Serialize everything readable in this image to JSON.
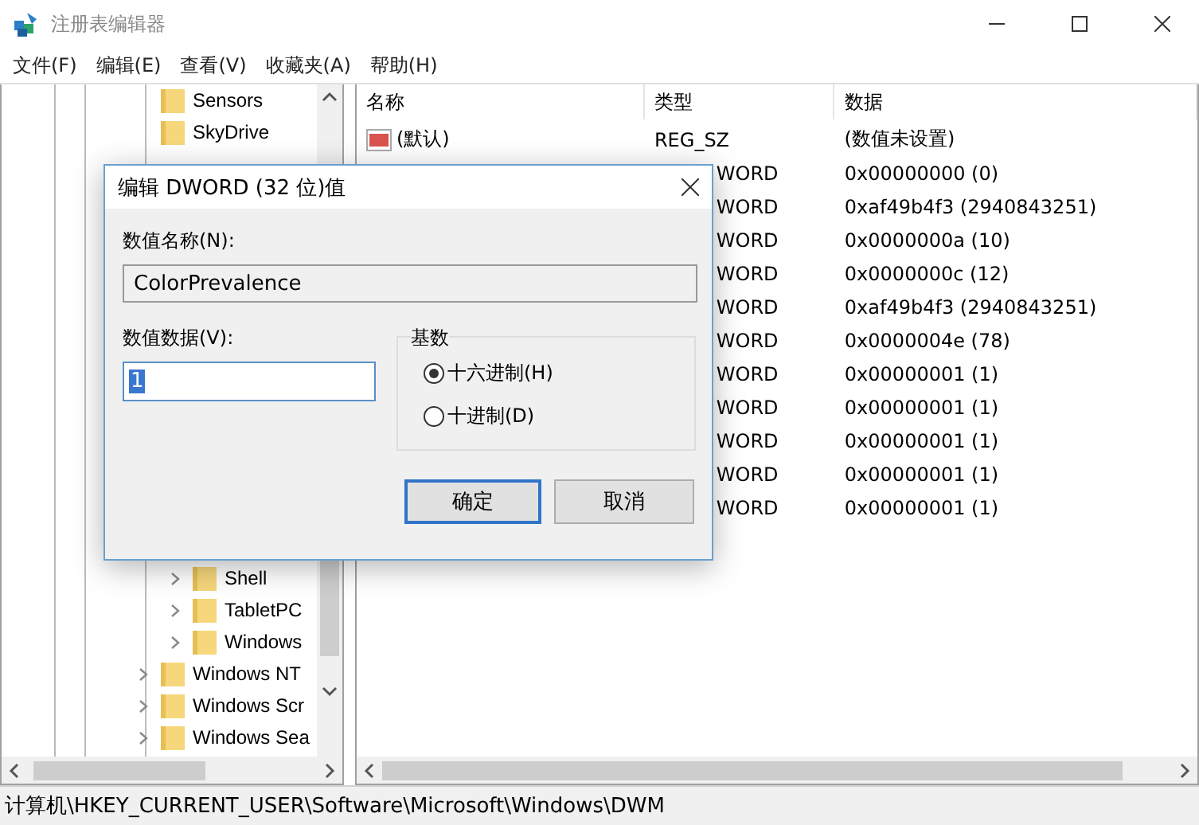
{
  "window": {
    "title": "注册表编辑器"
  },
  "menu": [
    "文件(F)",
    "编辑(E)",
    "查看(V)",
    "收藏夹(A)",
    "帮助(H)"
  ],
  "tree": {
    "items": [
      {
        "label": "Sensors",
        "has_children": false
      },
      {
        "label": "SkyDrive",
        "has_children": false
      },
      {
        "children": [
          {
            "label": "Shell",
            "has_children": true
          },
          {
            "label": "TabletPC",
            "has_children": true
          },
          {
            "label": "Windows",
            "has_children": true
          }
        ]
      },
      {
        "label": "Windows NT",
        "has_children": true
      },
      {
        "label": "Windows Scr",
        "has_children": true
      },
      {
        "label": "Windows Sea",
        "has_children": true
      }
    ]
  },
  "values": {
    "columns": [
      "名称",
      "类型",
      "数据"
    ],
    "rows": [
      {
        "kind": "string",
        "name": "(默认)",
        "type": "REG_SZ",
        "data": "(数值未设置)"
      },
      {
        "kind": "dword",
        "type": "WORD",
        "data": "0x00000000 (0)"
      },
      {
        "kind": "dword",
        "type": "WORD",
        "data": "0xaf49b4f3 (2940843251)"
      },
      {
        "kind": "dword",
        "type": "WORD",
        "data": "0x0000000a (10)"
      },
      {
        "kind": "dword",
        "type": "WORD",
        "data": "0x0000000c (12)"
      },
      {
        "kind": "dword",
        "type": "WORD",
        "data": "0xaf49b4f3 (2940843251)"
      },
      {
        "kind": "dword",
        "type": "WORD",
        "data": "0x0000004e (78)"
      },
      {
        "kind": "dword",
        "type": "WORD",
        "data": "0x00000001 (1)"
      },
      {
        "kind": "dword",
        "type": "WORD",
        "data": "0x00000001 (1)"
      },
      {
        "kind": "dword",
        "type": "WORD",
        "data": "0x00000001 (1)"
      },
      {
        "kind": "dword",
        "type": "WORD",
        "data": "0x00000001 (1)"
      },
      {
        "kind": "dword",
        "type": "WORD",
        "data": "0x00000001 (1)"
      }
    ]
  },
  "dialog": {
    "title": "编辑 DWORD (32 位)值",
    "name_label": "数值名称(N):",
    "name_value": "ColorPrevalence",
    "data_label": "数值数据(V):",
    "data_value": "1",
    "base_label": "基数",
    "bases": [
      {
        "label": "十六进制(H)",
        "selected": true
      },
      {
        "label": "十进制(D)",
        "selected": false
      }
    ],
    "buttons": [
      {
        "label": "确定",
        "default": true
      },
      {
        "label": "取消",
        "default": false
      }
    ]
  },
  "status_bar": "计算机\\HKEY_CURRENT_USER\\Software\\Microsoft\\Windows\\DWM"
}
